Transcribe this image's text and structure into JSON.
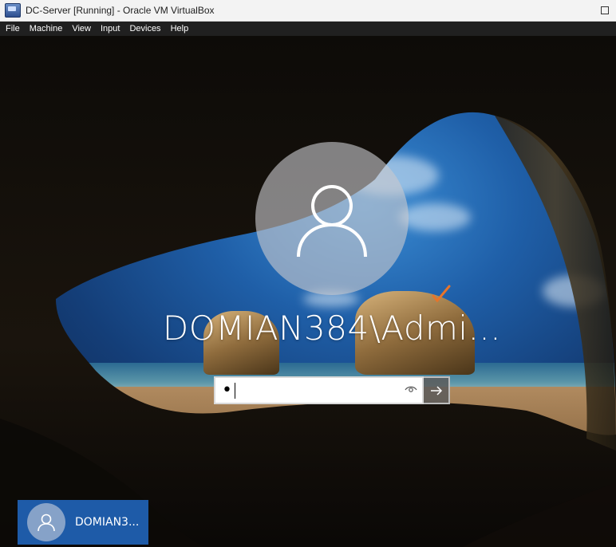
{
  "window": {
    "title": "DC-Server [Running] - Oracle VM VirtualBox",
    "icon": "virtualbox-icon"
  },
  "menubar": {
    "items": [
      "File",
      "Machine",
      "View",
      "Input",
      "Devices",
      "Help"
    ]
  },
  "login": {
    "username": "DOMIAN384\\Admi...",
    "password_value": "•",
    "reveal_icon": "eye-icon",
    "submit_icon": "arrow-right-icon",
    "avatar_icon": "user-icon"
  },
  "user_tile": {
    "name": "DOMIAN3..."
  },
  "colors": {
    "tile_accent": "#1e5ba8",
    "check_mark": "#e8742a"
  }
}
